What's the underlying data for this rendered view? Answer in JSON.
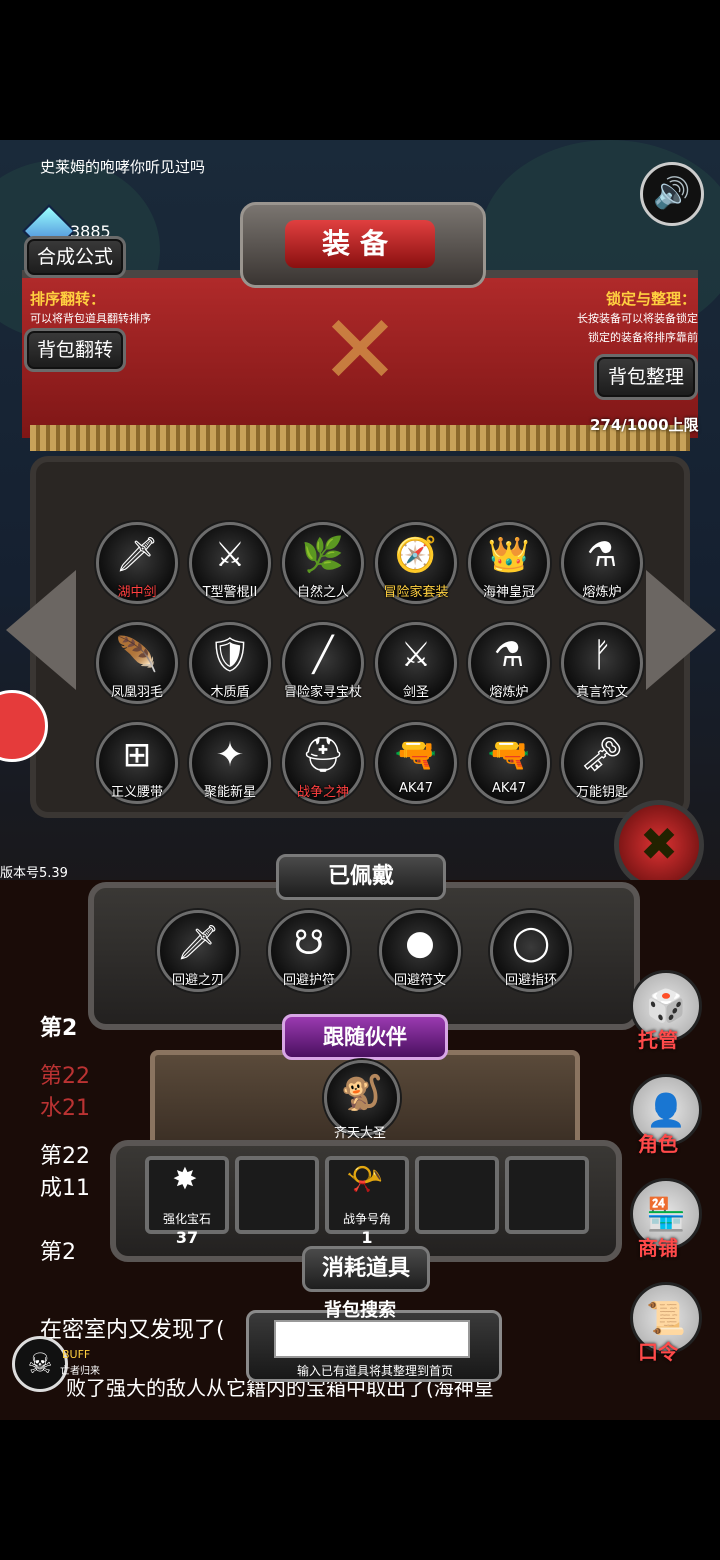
{
  "top_message": "史莱姆的咆哮你听见过吗",
  "currency": {
    "value": "3885",
    "icon": "blue-gem-icon"
  },
  "buttons": {
    "formula": "合成公式",
    "flip_bag": "背包翻转",
    "sort_bag": "背包整理"
  },
  "title": "装备",
  "hint_left": {
    "title": "排序翻转：",
    "desc": "可以将背包道具翻转排序"
  },
  "hint_right": {
    "title": "锁定与整理：",
    "desc1": "长按装备可以将装备锁定",
    "desc2": "锁定的装备将排序靠前"
  },
  "capacity": "274/1000上限",
  "items": [
    {
      "label": "湖中剑",
      "icon": "sword-icon",
      "glyph": "🗡",
      "style": "red"
    },
    {
      "label": "T型警棍II",
      "icon": "baton-icon",
      "glyph": "⚔",
      "style": ""
    },
    {
      "label": "自然之人",
      "icon": "nature-man-icon",
      "glyph": "🌿",
      "style": ""
    },
    {
      "label": "冒险家套装",
      "icon": "adventurer-suit-icon",
      "glyph": "🧭",
      "style": "gold"
    },
    {
      "label": "海神皇冠",
      "icon": "crown-icon",
      "glyph": "👑",
      "style": ""
    },
    {
      "label": "熔炼炉",
      "icon": "furnace-icon",
      "glyph": "⚗",
      "style": ""
    },
    {
      "label": "凤凰羽毛",
      "icon": "feather-icon",
      "glyph": "🪶",
      "style": ""
    },
    {
      "label": "木质盾",
      "icon": "shield-icon",
      "glyph": "🛡",
      "style": ""
    },
    {
      "label": "冒险家寻宝杖",
      "icon": "staff-icon",
      "glyph": "╱",
      "style": ""
    },
    {
      "label": "剑圣",
      "icon": "sword-saint-icon",
      "glyph": "⚔",
      "style": ""
    },
    {
      "label": "熔炼炉",
      "icon": "furnace-icon",
      "glyph": "⚗",
      "style": ""
    },
    {
      "label": "真言符文",
      "icon": "rune-icon",
      "glyph": "ᚠ",
      "style": ""
    },
    {
      "label": "正义腰带",
      "icon": "belt-icon",
      "glyph": "⊞",
      "style": ""
    },
    {
      "label": "聚能新星",
      "icon": "nova-icon",
      "glyph": "✦",
      "style": ""
    },
    {
      "label": "战争之神",
      "icon": "war-god-icon",
      "glyph": "⛑",
      "style": "red"
    },
    {
      "label": "AK47",
      "icon": "rifle-icon",
      "glyph": "🔫",
      "style": ""
    },
    {
      "label": "AK47",
      "icon": "rifle-icon",
      "glyph": "🔫",
      "style": ""
    },
    {
      "label": "万能钥匙",
      "icon": "key-icon",
      "glyph": "🗝",
      "style": ""
    }
  ],
  "version": "版本号5.39",
  "equipped": {
    "title": "已佩戴",
    "slots": [
      {
        "label": "回避之刃",
        "icon": "blade-icon",
        "glyph": "🗡"
      },
      {
        "label": "回避护符",
        "icon": "amulet-icon",
        "glyph": "☋"
      },
      {
        "label": "回避符文",
        "icon": "rune-orb-icon",
        "glyph": "●"
      },
      {
        "label": "回避指环",
        "icon": "ring-icon",
        "glyph": "◯"
      }
    ]
  },
  "companion": {
    "title": "跟随伙伴",
    "name": "齐天大圣",
    "icon": "monkey-king-icon"
  },
  "consumables": {
    "title": "消耗道具",
    "slots": [
      {
        "label": "强化宝石",
        "count": "37",
        "icon": "gem-icon",
        "glyph": "✸"
      },
      {
        "label": "",
        "count": "",
        "icon": "",
        "glyph": ""
      },
      {
        "label": "战争号角",
        "count": "1",
        "icon": "horn-icon",
        "glyph": "📯"
      },
      {
        "label": "",
        "count": "",
        "icon": "",
        "glyph": ""
      },
      {
        "label": "",
        "count": "",
        "icon": "",
        "glyph": ""
      }
    ]
  },
  "search": {
    "title": "背包搜索",
    "hint": "输入已有道具将其整理到首页",
    "value": ""
  },
  "side_menu": [
    "托管",
    "角色",
    "商铺",
    "口令"
  ],
  "buff": {
    "label": "BUFF",
    "sub": "亡者归来"
  },
  "background_text": {
    "l1": "第2",
    "l2": "第22",
    "l3": "水21",
    "l4": "第22",
    "l5": "成11",
    "l6": "第2",
    "l7": "在密室内又发现了(",
    "l8": "败了强大的敌人从它籍内的宝箱中取出了(海神皇"
  }
}
